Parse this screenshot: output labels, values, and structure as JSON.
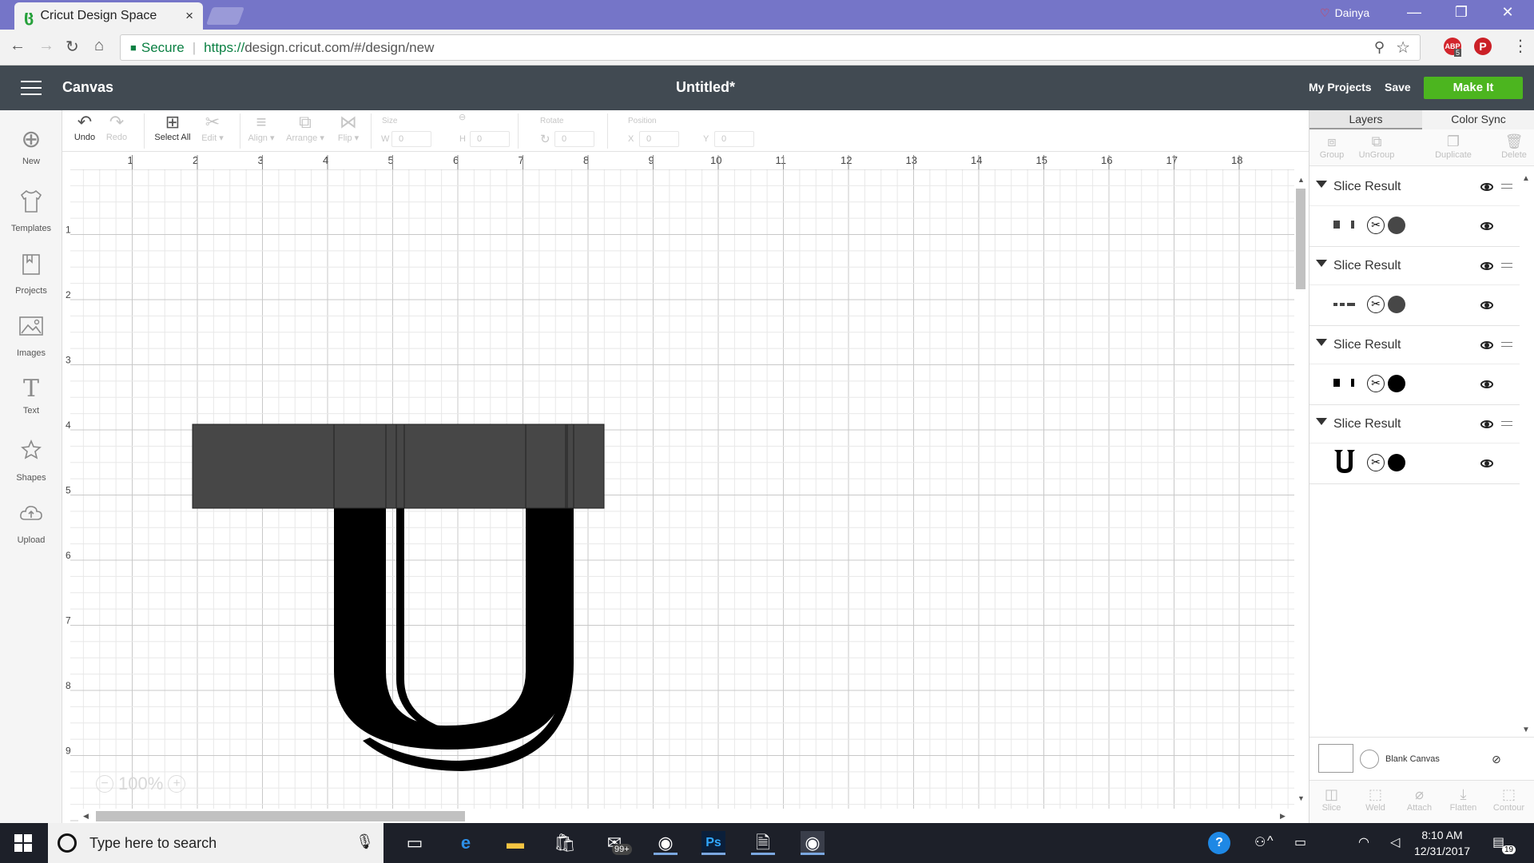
{
  "browser": {
    "tab_title": "Cricut Design Space",
    "tab_close": "×",
    "profile_name": "Dainya",
    "secure_label": "Secure",
    "url_scheme": "https://",
    "url_rest": "design.cricut.com/#/design/new",
    "adblock_badge": "5"
  },
  "app": {
    "menu_title": "Canvas",
    "doc_title": "Untitled*",
    "my_projects": "My Projects",
    "save": "Save",
    "make_it": "Make It",
    "accent_color": "#4cb51f",
    "header_color": "#414a52"
  },
  "sidebar": {
    "items": [
      {
        "label": "New",
        "icon": "plus-circle-icon"
      },
      {
        "label": "Templates",
        "icon": "tshirt-icon"
      },
      {
        "label": "Projects",
        "icon": "projects-icon"
      },
      {
        "label": "Images",
        "icon": "image-icon"
      },
      {
        "label": "Text",
        "icon": "text-icon"
      },
      {
        "label": "Shapes",
        "icon": "shapes-icon"
      },
      {
        "label": "Upload",
        "icon": "cloud-upload-icon"
      }
    ]
  },
  "toolbar": {
    "undo": "Undo",
    "redo": "Redo",
    "select_all": "Select All",
    "edit": "Edit",
    "align": "Align",
    "arrange": "Arrange",
    "flip": "Flip",
    "size": "Size",
    "w": "W",
    "h": "H",
    "rotate": "Rotate",
    "position": "Position",
    "x": "X",
    "y": "Y",
    "w_value": "0",
    "h_value": "0",
    "rotate_value": "0",
    "x_value": "0",
    "y_value": "0"
  },
  "canvas": {
    "ruler_top": [
      "1",
      "2",
      "3",
      "4",
      "5",
      "6",
      "7",
      "8",
      "9",
      "10",
      "11",
      "12",
      "13",
      "14",
      "15",
      "16",
      "17",
      "18"
    ],
    "ruler_left": [
      "1",
      "2",
      "3",
      "4",
      "5",
      "6",
      "7",
      "8",
      "9"
    ],
    "zoom": "100%",
    "letter_color": "#000000",
    "band_color": "#474747"
  },
  "panel": {
    "tab_layers": "Layers",
    "tab_color_sync": "Color Sync",
    "actions": [
      "Group",
      "UnGroup",
      "Duplicate",
      "Delete"
    ],
    "layers": [
      {
        "title": "Slice Result",
        "color": "#474747"
      },
      {
        "title": "Slice Result",
        "color": "#474747"
      },
      {
        "title": "Slice Result",
        "color": "#000000"
      },
      {
        "title": "Slice Result",
        "color": "#000000"
      }
    ],
    "blank_canvas": "Blank Canvas",
    "bottom_actions": [
      "Slice",
      "Weld",
      "Attach",
      "Flatten",
      "Contour"
    ]
  },
  "taskbar": {
    "search_placeholder": "Type here to search",
    "mail_badge": "99+",
    "time": "8:10 AM",
    "date": "12/31/2017",
    "notif_count": "19"
  }
}
